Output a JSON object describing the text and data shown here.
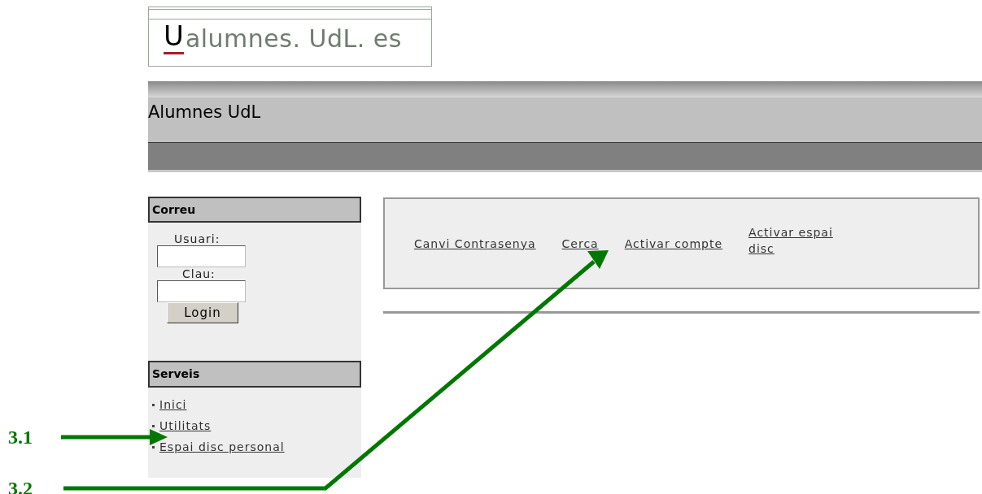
{
  "logo": {
    "mark": "U",
    "text": "alumnes. UdL. es"
  },
  "header": {
    "title": "Alumnes UdL"
  },
  "sidebar": {
    "login_panel": {
      "title": "Correu",
      "user_label": "Usuari:",
      "password_label": "Clau:",
      "button": "Login"
    },
    "services_panel": {
      "title": "Serveis",
      "items": [
        {
          "label": "Inici"
        },
        {
          "label": "Utilitats"
        },
        {
          "label": "Espai disc personal"
        }
      ]
    }
  },
  "menu": {
    "links": [
      {
        "label": "Canvi Contrasenya"
      },
      {
        "label": "Cerca"
      },
      {
        "label": "Activar compte"
      },
      {
        "label": "Activar espai disc"
      }
    ]
  },
  "annotations": [
    {
      "label": "3.1"
    },
    {
      "label": "3.2"
    }
  ]
}
